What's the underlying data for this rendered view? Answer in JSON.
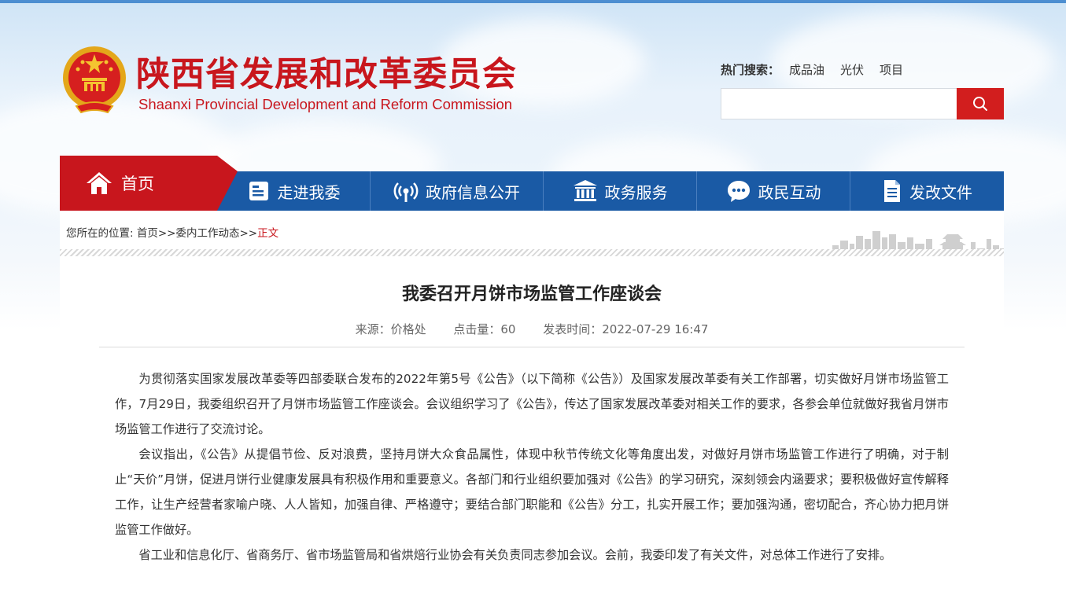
{
  "header": {
    "title": "陕西省发展和改革委员会",
    "subtitle": "Shaanxi Provincial Development and Reform Commission",
    "hot_search_label": "热门搜索：",
    "hot_search_items": [
      "成品油",
      "光伏",
      "项目"
    ],
    "search_placeholder": ""
  },
  "nav": {
    "home": "首页",
    "items": [
      "走进我委",
      "政府信息公开",
      "政务服务",
      "政民互动",
      "发改文件"
    ]
  },
  "breadcrumb": {
    "prefix": "您所在的位置:",
    "home": "首页",
    "sep1": ">>",
    "section": "委内工作动态",
    "sep2": ">>",
    "current": "正文"
  },
  "article": {
    "title": "我委召开月饼市场监管工作座谈会",
    "source": "来源：价格处",
    "views": "点击量：60",
    "published": "发表时间：2022-07-29 16:47",
    "paragraphs": [
      "为贯彻落实国家发展改革委等四部委联合发布的2022年第5号《公告》（以下简称《公告》）及国家发展改革委有关工作部署，切实做好月饼市场监管工作，7月29日，我委组织召开了月饼市场监管工作座谈会。会议组织学习了《公告》，传达了国家发展改革委对相关工作的要求，各参会单位就做好我省月饼市场监管工作进行了交流讨论。",
      "会议指出，《公告》从提倡节俭、反对浪费，坚持月饼大众食品属性，体现中秋节传统文化等角度出发，对做好月饼市场监管工作进行了明确，对于制止“天价”月饼，促进月饼行业健康发展具有积极作用和重要意义。各部门和行业组织要加强对《公告》的学习研究，深刻领会内涵要求；要积极做好宣传解释工作，让生产经营者家喻户晓、人人皆知，加强自律、严格遵守；要结合部门职能和《公告》分工，扎实开展工作；要加强沟通，密切配合，齐心协力把月饼监管工作做好。",
      "省工业和信息化厅、省商务厅、省市场监管局和省烘焙行业协会有关负责同志参加会议。会前，我委印发了有关文件，对总体工作进行了安排。"
    ]
  },
  "colors": {
    "brand_red": "#c8161d",
    "nav_blue": "#1a5aa5"
  }
}
